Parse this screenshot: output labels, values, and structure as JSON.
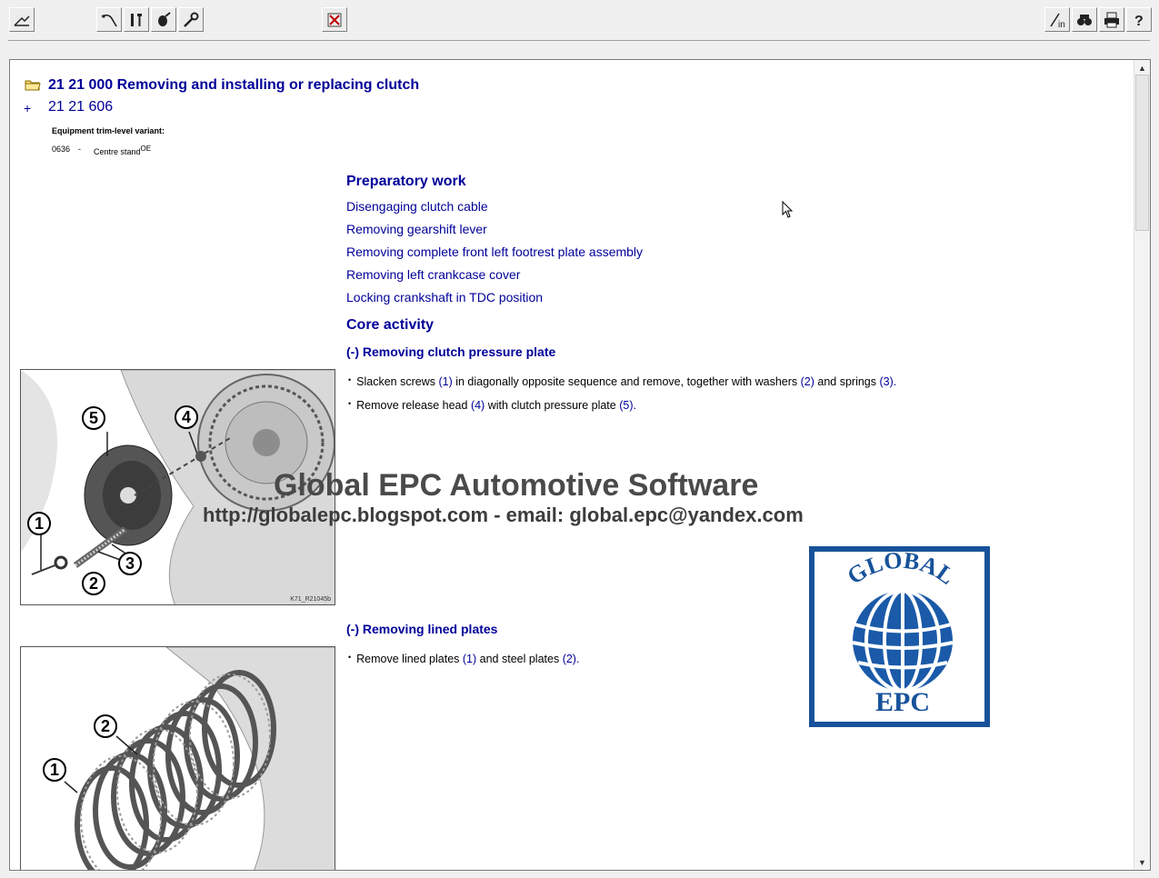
{
  "toolbar": {
    "left_buttons": [
      "navigate-icon",
      "wiring-icon",
      "tools-icon",
      "lubricant-icon",
      "wrench-icon",
      "close-doc-icon"
    ],
    "right_buttons": [
      "info-icon",
      "search-icon",
      "print-icon",
      "help-icon"
    ]
  },
  "document": {
    "title": "21 21 000 Removing and installing or replacing clutch",
    "subtitle_prefix": "+",
    "subtitle": "21 21 606",
    "equipment_label": "Equipment trim-level variant:",
    "equipment_code": "0636",
    "equipment_dash": "-",
    "equipment_name": "Centre stand",
    "equipment_sup": "OE",
    "preparatory_heading": "Preparatory work",
    "preparatory_links": [
      "Disengaging clutch cable",
      "Removing gearshift lever",
      "Removing complete front left footrest plate assembly",
      "Removing left crankcase cover",
      "Locking crankshaft in TDC position"
    ],
    "core_heading": "Core activity",
    "steps": [
      {
        "heading": "(-) Removing clutch pressure plate",
        "figure_code": "K71_R21045b",
        "figure_labels": [
          "1",
          "2",
          "3",
          "4",
          "5"
        ],
        "bullets": [
          {
            "parts": [
              "Slacken screws ",
              "(1)",
              " in diagonally opposite sequence and remove, together with washers ",
              "(2)",
              " and springs ",
              "(3)",
              "."
            ]
          },
          {
            "parts": [
              "Remove release head ",
              "(4)",
              " with clutch pressure plate ",
              "(5)",
              "."
            ]
          }
        ]
      },
      {
        "heading": "(-) Removing lined plates",
        "figure_labels": [
          "1",
          "2"
        ],
        "bullets": [
          {
            "parts": [
              "Remove lined plates ",
              "(1)",
              " and steel plates ",
              "(2)",
              "."
            ]
          }
        ]
      }
    ]
  },
  "watermark": {
    "title": "Global EPC Automotive Software",
    "subtitle": "http://globalepc.blogspot.com - email: global.epc@yandex.com",
    "logo_top": "GLOBAL",
    "logo_bottom": "EPC"
  },
  "colors": {
    "link_blue": "#000099",
    "logo_blue": "#17529a"
  }
}
